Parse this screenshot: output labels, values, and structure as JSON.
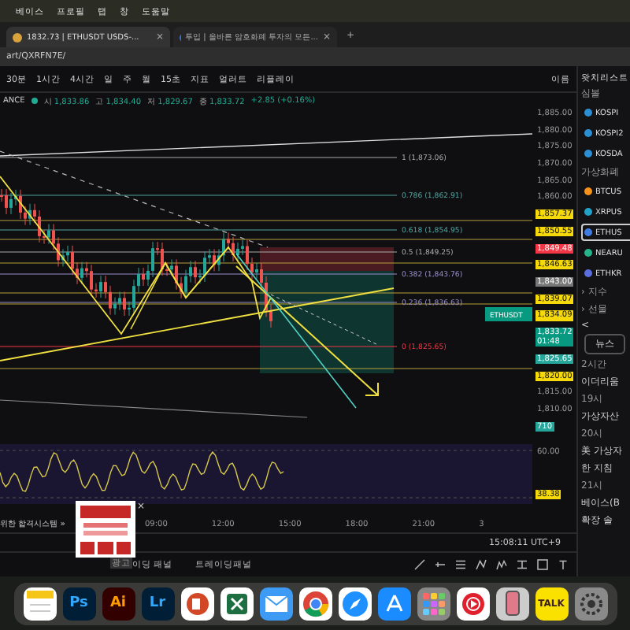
{
  "menu_bar": {
    "items": [
      "베이스",
      "프로필",
      "탭",
      "창",
      "도움말"
    ]
  },
  "browser": {
    "tabs": [
      {
        "title": "1832.73 | ETHUSDT USDS-...",
        "close": "×",
        "selected": true
      },
      {
        "title": "투입 | 올바른 암호화폐 투자의 모든...",
        "close": "×",
        "selected": false
      }
    ],
    "new_tab": "+",
    "url": "art/QXRFN7E/"
  },
  "toolbar": {
    "intervals": [
      {
        "label": "30분",
        "selected": false
      },
      {
        "label": "1시간",
        "selected": false
      },
      {
        "label": "4시간",
        "selected": false
      },
      {
        "label": "일",
        "selected": false
      },
      {
        "label": "주",
        "selected": false
      },
      {
        "label": "월",
        "selected": false
      },
      {
        "label": "15초",
        "selected": false
      }
    ],
    "indicators": "지표",
    "alert": "얼러트",
    "replay": "리플레이",
    "layout": "이름"
  },
  "symbol_bar": {
    "exchange": "ANCE",
    "quotes": [
      {
        "label": "시",
        "value": "1,833.86"
      },
      {
        "label": "고",
        "value": "1,834.40"
      },
      {
        "label": "저",
        "value": "1,829.67"
      },
      {
        "label": "종",
        "value": "1,833.72"
      }
    ],
    "change": "+2.85 (+0.16%)"
  },
  "chart": {
    "fib_levels": [
      "1 (1,873.06)",
      "0.786 (1,862.91)",
      "0.618 (1,854.95)",
      "0.5 (1,849.25)",
      "0.382 (1,843.76)",
      "0.236 (1,836.63)",
      "0 (1,825.65)"
    ],
    "symbol_tag": "ETHUSDT",
    "price_axis": [
      {
        "text": "1,885.00",
        "kind": "tick"
      },
      {
        "text": "1,880.00",
        "kind": "tick"
      },
      {
        "text": "1,875.00",
        "kind": "tick"
      },
      {
        "text": "1,870.00",
        "kind": "tick"
      },
      {
        "text": "1,865.00",
        "kind": "tick"
      },
      {
        "text": "1,860.00",
        "kind": "tick"
      },
      {
        "text": "1,857.37",
        "kind": "yellow"
      },
      {
        "text": "1,850.55",
        "kind": "yellow"
      },
      {
        "text": "1,849.48",
        "kind": "red"
      },
      {
        "text": "1,846.63",
        "kind": "yellow"
      },
      {
        "text": "1,843.00",
        "kind": "grey"
      },
      {
        "text": "1,839.07",
        "kind": "yellow"
      },
      {
        "text": "1,834.09",
        "kind": "yellow"
      },
      {
        "text": "1,833.72",
        "kind": "last",
        "sub": "01:48"
      },
      {
        "text": "1,825.65",
        "kind": "teal"
      },
      {
        "text": "1,820.00",
        "kind": "yellow"
      },
      {
        "text": "1,815.00",
        "kind": "tick"
      },
      {
        "text": "1,810.00",
        "kind": "tick"
      },
      {
        "text": "710",
        "kind": "teal"
      }
    ]
  },
  "indicator": {
    "axis": [
      {
        "text": "60.00",
        "kind": "tick"
      },
      {
        "text": "38.38",
        "kind": "yellow"
      }
    ]
  },
  "time_axis": [
    "09:00",
    "12:00",
    "15:00",
    "18:00",
    "21:00",
    "3"
  ],
  "promo_text": "위한 합격시스템 »",
  "ad": {
    "close": "×",
    "label": "광고"
  },
  "clock": "15:08:11 UTC+9",
  "bottom_tabs": [
    "이딩 패널",
    "트레이딩패널"
  ],
  "watchlist": {
    "title": "왓치리스트",
    "column": "심볼",
    "groups": [
      {
        "items": [
          {
            "symbol": "KOSPI",
            "color": "#2b8fd6",
            "selected": false
          },
          {
            "symbol": "KOSPI2",
            "color": "#2b8fd6",
            "selected": false
          },
          {
            "symbol": "KOSDA",
            "color": "#2b8fd6",
            "selected": false
          }
        ]
      },
      {
        "title": "가상화폐",
        "items": [
          {
            "symbol": "BTCUS",
            "color": "#f7931a",
            "selected": false
          },
          {
            "symbol": "XRPUS",
            "color": "#23a2c9",
            "selected": false
          },
          {
            "symbol": "ETHUS",
            "color": "#3f7be0",
            "selected": true
          },
          {
            "symbol": "NEARU",
            "color": "#25b38a",
            "selected": false
          },
          {
            "symbol": "ETHKR",
            "color": "#5b6ee0",
            "selected": false
          }
        ]
      }
    ],
    "folders": [
      "› 지수",
      "› 선물"
    ],
    "back": "<",
    "news_button": "뉴스",
    "news": [
      {
        "time": "2시간",
        "lines": [
          "이더리움"
        ]
      },
      {
        "time": "19시",
        "lines": [
          "가상자산"
        ]
      },
      {
        "time": "20시",
        "lines": [
          "美 가상자",
          "한 지침"
        ]
      },
      {
        "time": "21시",
        "lines": [
          "베이스(B",
          "확장 솔"
        ]
      }
    ]
  },
  "dock": [
    {
      "kind": "notes"
    },
    {
      "kind": "ps",
      "label": "Ps"
    },
    {
      "kind": "ai",
      "label": "Ai"
    },
    {
      "kind": "lr",
      "label": "Lr"
    },
    {
      "kind": "powerpoint"
    },
    {
      "kind": "excel"
    },
    {
      "kind": "mail"
    },
    {
      "kind": "chrome"
    },
    {
      "kind": "safari"
    },
    {
      "kind": "appstore"
    },
    {
      "kind": "launchpad"
    },
    {
      "kind": "music"
    },
    {
      "kind": "phone"
    },
    {
      "kind": "talk",
      "label": "TALK"
    },
    {
      "kind": "settings"
    }
  ]
}
